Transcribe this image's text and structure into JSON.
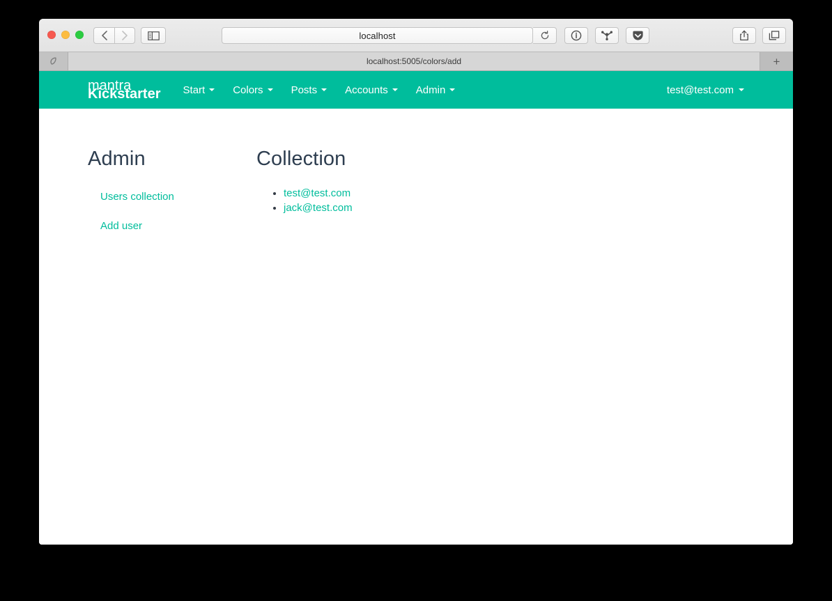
{
  "browser": {
    "url_field_text": "localhost",
    "tab_title": "localhost:5005/colors/add",
    "new_tab_label": "+",
    "controls": {
      "back": "back-arrow",
      "forward": "forward-arrow",
      "sidebar": "sidebar-toggle-icon",
      "reload": "reload-icon",
      "info": "info-circle-icon",
      "share_network": "share-network-icon",
      "pocket": "pocket-icon",
      "upload": "share-upload-icon",
      "tabs": "show-tabs-icon"
    },
    "traffic_lights": [
      "close",
      "minimize",
      "zoom"
    ]
  },
  "colors": {
    "brand_teal": "#00bd9c",
    "heading_navy": "#2e3e50",
    "link_teal": "#00bd9c",
    "window_chrome": "#ececec",
    "tabstrip": "#d2d2d2"
  },
  "navbar": {
    "brand_light": "mantra",
    "brand_bold": "Kickstarter",
    "items": [
      {
        "label": "Start",
        "has_caret": true
      },
      {
        "label": "Colors",
        "has_caret": true
      },
      {
        "label": "Posts",
        "has_caret": true
      },
      {
        "label": "Accounts",
        "has_caret": true
      },
      {
        "label": "Admin",
        "has_caret": true
      }
    ],
    "user": {
      "label": "test@test.com",
      "has_caret": true
    }
  },
  "content": {
    "left": {
      "heading": "Admin",
      "links": [
        {
          "label": "Users collection"
        },
        {
          "label": "Add user"
        }
      ]
    },
    "right": {
      "heading": "Collection",
      "items": [
        {
          "label": "test@test.com"
        },
        {
          "label": "jack@test.com"
        }
      ]
    }
  }
}
